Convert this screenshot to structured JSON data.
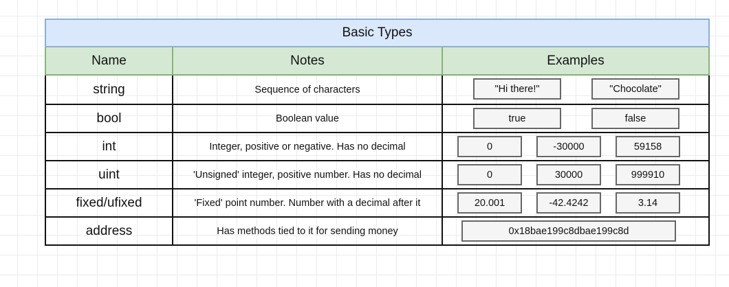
{
  "title": "Basic Types",
  "headers": {
    "name": "Name",
    "notes": "Notes",
    "examples": "Examples"
  },
  "rows": [
    {
      "name": "string",
      "notes": "Sequence of characters",
      "examples": [
        "\"Hi there!\"",
        "\"Chocolate\""
      ]
    },
    {
      "name": "bool",
      "notes": "Boolean value",
      "examples": [
        "true",
        "false"
      ]
    },
    {
      "name": "int",
      "notes": "Integer, positive or negative.  Has no decimal",
      "examples": [
        "0",
        "-30000",
        "59158"
      ]
    },
    {
      "name": "uint",
      "notes": "'Unsigned' integer, positive number.  Has no decimal",
      "examples": [
        "0",
        "30000",
        "999910"
      ]
    },
    {
      "name": "fixed/ufixed",
      "notes": "'Fixed' point number.  Number with a decimal after it",
      "examples": [
        "20.001",
        "-42.4242",
        "3.14"
      ]
    },
    {
      "name": "address",
      "notes": "Has methods tied to it for sending money",
      "examples": [
        "0x18bae199c8dbae199c8d"
      ]
    }
  ]
}
